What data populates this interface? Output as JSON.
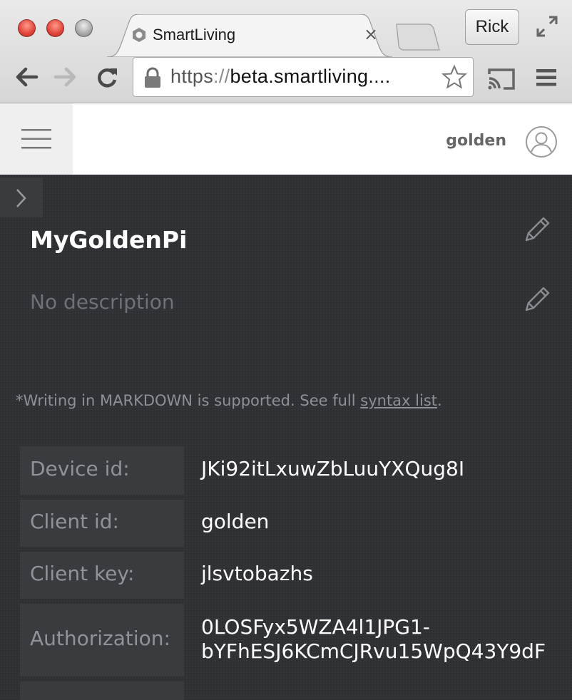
{
  "browser": {
    "tab_title": "SmartLiving",
    "tab_close": "×",
    "profile_name": "Rick",
    "url_scheme": "https",
    "url_separator": "://",
    "url_host": "beta.smartliving....",
    "icons": [
      "back-icon",
      "forward-icon",
      "reload-icon",
      "lock-icon",
      "star-icon",
      "cast-icon",
      "menu-icon",
      "fullscreen-icon"
    ]
  },
  "header": {
    "username": "golden",
    "avatar_icon": "user-circle-icon",
    "menu_icon": "hamburger-icon"
  },
  "device": {
    "name": "MyGoldenPi",
    "description": "No description",
    "markdown_note_prefix": "*Writing in MARKDOWN is supported. See full ",
    "markdown_link": "syntax list",
    "markdown_note_suffix": ".",
    "properties": [
      {
        "label": "Device id:",
        "value": "JKi92itLxuwZbLuuYXQug8I"
      },
      {
        "label": "Client id:",
        "value": "golden"
      },
      {
        "label": "Client key:",
        "value": "jlsvtobazhs"
      },
      {
        "label": "Authorization:",
        "value": "0LOSFyx5WZA4l1JPG1-",
        "value_line2": "bYFhESJ6KCmCJRvu15WpQ43Y9dF"
      }
    ]
  },
  "colors": {
    "panel_bg": "#2f3033",
    "label_cell_bg": "#3a3b3e",
    "label_text": "#8f9297",
    "value_text": "#ffffff"
  }
}
